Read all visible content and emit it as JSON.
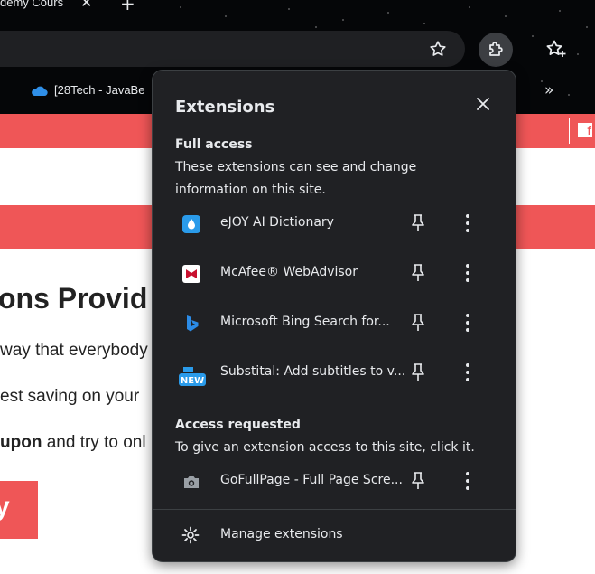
{
  "browser": {
    "tab_title": "demy Cours",
    "bookmark_label": "[28Tech - JavaBe",
    "more_bookmarks": "»"
  },
  "page": {
    "heading": "ons Provid",
    "lines": [
      "way that everybody",
      "est saving on your",
      "and try to onl"
    ],
    "bold_word": "upon",
    "cta_label": "y"
  },
  "extensions_popup": {
    "title": "Extensions",
    "full_access": {
      "title": "Full access",
      "description": "These extensions can see and change information on this site.",
      "items": [
        {
          "name": "eJOY AI Dictionary",
          "icon": "ejoy-icon"
        },
        {
          "name": "McAfee® WebAdvisor",
          "icon": "mcafee-icon"
        },
        {
          "name": "Microsoft Bing Search for...",
          "icon": "bing-icon"
        },
        {
          "name": "Substital: Add subtitles to v...",
          "icon": "substital-icon",
          "badge": "NEW"
        }
      ]
    },
    "access_requested": {
      "title": "Access requested",
      "description": "To give an extension access to this site, click it.",
      "items": [
        {
          "name": "GoFullPage - Full Page Scre...",
          "icon": "camera-icon"
        }
      ]
    },
    "manage_label": "Manage extensions"
  },
  "colors": {
    "accent_red": "#ef5657",
    "popup_bg": "#202124",
    "popup_text": "#e8eaed"
  }
}
